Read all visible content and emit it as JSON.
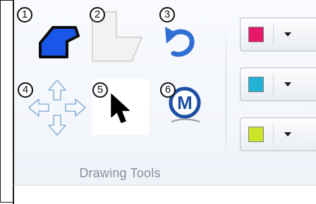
{
  "group": {
    "label": "Drawing Tools"
  },
  "badges": [
    "1",
    "2",
    "3",
    "4",
    "5",
    "6"
  ],
  "tools": [
    {
      "icon": "blue-polygon-shape-icon"
    },
    {
      "icon": "disabled-shape-icon"
    },
    {
      "icon": "undo-arrow-icon"
    },
    {
      "icon": "pan-arrows-icon"
    },
    {
      "icon": "pointer-arrow-icon"
    },
    {
      "icon": "m-circle-icon"
    }
  ],
  "colors": {
    "shape_fill": "#1a57e8",
    "pick1": "#e6186b",
    "pick2": "#22b2d3",
    "pick3": "#cbe42a"
  }
}
